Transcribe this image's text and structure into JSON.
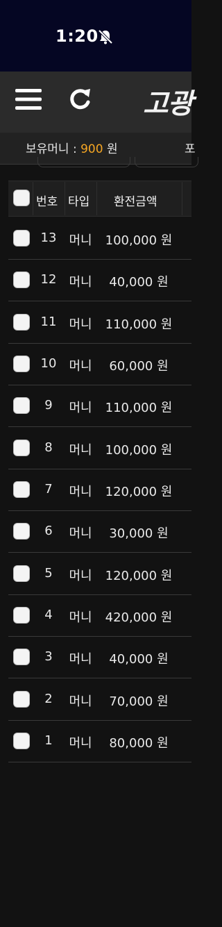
{
  "status_bar": {
    "time": "1:20"
  },
  "header": {
    "logo_text": "고광"
  },
  "balance": {
    "label": "보유머니 : ",
    "value": "900",
    "unit": " 원",
    "next_text": "포"
  },
  "table": {
    "headers": {
      "number": "번호",
      "type": "타입",
      "amount": "환전금액"
    },
    "rows": [
      {
        "number": "13",
        "type": "머니",
        "amount": "100,000 원"
      },
      {
        "number": "12",
        "type": "머니",
        "amount": "40,000 원"
      },
      {
        "number": "11",
        "type": "머니",
        "amount": "110,000 원"
      },
      {
        "number": "10",
        "type": "머니",
        "amount": "60,000 원"
      },
      {
        "number": "9",
        "type": "머니",
        "amount": "110,000 원"
      },
      {
        "number": "8",
        "type": "머니",
        "amount": "100,000 원"
      },
      {
        "number": "7",
        "type": "머니",
        "amount": "120,000 원"
      },
      {
        "number": "6",
        "type": "머니",
        "amount": "30,000 원"
      },
      {
        "number": "5",
        "type": "머니",
        "amount": "120,000 원"
      },
      {
        "number": "4",
        "type": "머니",
        "amount": "420,000 원"
      },
      {
        "number": "3",
        "type": "머니",
        "amount": "40,000 원"
      },
      {
        "number": "2",
        "type": "머니",
        "amount": "70,000 원"
      },
      {
        "number": "1",
        "type": "머니",
        "amount": "80,000 원"
      }
    ]
  },
  "colors": {
    "accent": "#f5a623",
    "status_bar_bg": "#050623",
    "app_bar_bg": "#2b2b2b",
    "page_bg": "#121212"
  }
}
